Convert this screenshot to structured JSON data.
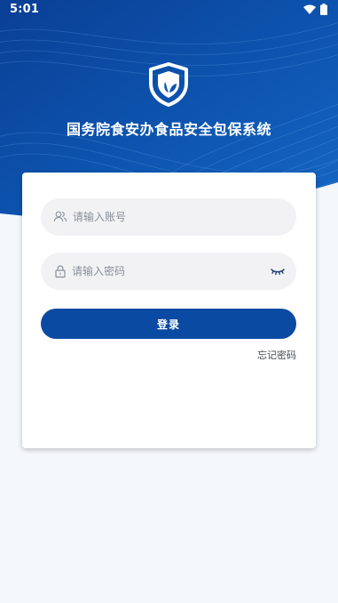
{
  "status_bar": {
    "time": "5:01",
    "icons": [
      "wifi-icon",
      "battery-icon"
    ]
  },
  "header": {
    "title": "国务院食安办食品安全包保系统",
    "logo_icon": "shield-leaf-icon"
  },
  "login": {
    "account_placeholder": "请输入账号",
    "password_placeholder": "请输入密码",
    "account_icon": "user-icon",
    "password_icon": "lock-icon",
    "toggle_icon": "eye-closed-icon",
    "submit_label": "登录",
    "forgot_label": "忘记密码"
  },
  "colors": {
    "primary": "#0b4aa2",
    "header_dark": "#0a3f95",
    "header_light": "#2f7fd0",
    "background": "#f4f7fc",
    "field_bg": "#f2f2f4"
  }
}
